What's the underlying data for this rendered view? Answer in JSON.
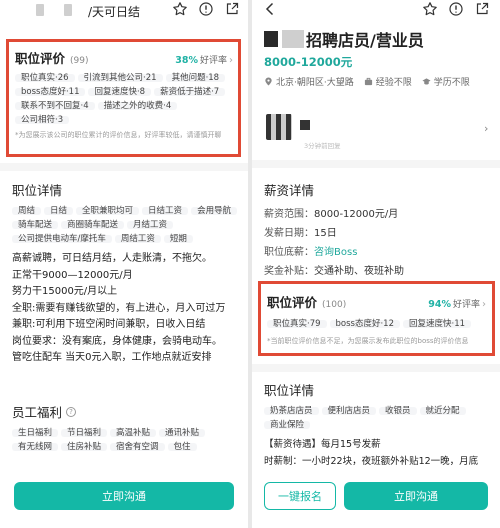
{
  "left": {
    "header": {
      "title": "/天可日结"
    },
    "evaluation": {
      "title": "职位评价",
      "count": "(99)",
      "percent": "38%",
      "good_label": "好评率",
      "tags": [
        "职位真实·26",
        "引流到其他公司·21",
        "其他问题·18",
        "boss态度好·11",
        "回复速度快·8",
        "薪资低于描述·7",
        "联系不到不回复·4",
        "描述之外的收费·4",
        "公司相符·3"
      ],
      "note": "*为您展示该公司的职位累计的评价信息，好评率较低，请谨慎开聊"
    },
    "details": {
      "title": "职位详情",
      "tags": [
        "周结",
        "日结",
        "全职兼职均可",
        "日结工资",
        "会用导航",
        "骑车配送",
        "商圈骑车配送",
        "月结工资",
        "公司提供电动车/摩托车",
        "周结工资",
        "短期"
      ],
      "lines": [
        "高薪诚聘，可日结月结，人走账清，不拖欠。",
        "正常干9000—12000元/月",
        "努力干15000元/月以上",
        "全职:需要有赚钱欲望的，有上进心，月入可过万",
        "兼职:可利用下班空闲时间兼职，日收入日结",
        "岗位要求：没有案底，身体健康，会骑电动车。",
        "管吃住配车 当天0元入职，工作地点就近安排"
      ]
    },
    "benefits": {
      "title": "员工福利",
      "tags": [
        "生日福利",
        "节日福利",
        "高温补贴",
        "通讯补贴",
        "有无线网",
        "住房补贴",
        "宿舍有空调",
        "包住"
      ]
    },
    "cta": "立即沟通"
  },
  "right": {
    "header": {},
    "job": {
      "title": "招聘店员/营业员",
      "salary": "8000-12000元",
      "location": "北京·朝阳区·大望路",
      "experience": "经验不限",
      "education": "学历不限"
    },
    "recruiter": {
      "status": "3分钟前回复"
    },
    "salary_info": {
      "title": "薪资详情",
      "range_label": "薪资范围：",
      "range": "8000-12000元/月",
      "payday_label": "发薪日期：",
      "payday": "15日",
      "base_label": "职位底薪：",
      "base": "咨询Boss",
      "bonus_label": "奖金补贴：",
      "bonus": "交通补助、夜班补助"
    },
    "evaluation": {
      "title": "职位评价",
      "count": "(100)",
      "percent": "94%",
      "good_label": "好评率",
      "tags": [
        "职位真实·79",
        "boss态度好·12",
        "回复速度快·11"
      ],
      "note": "*当前职位评价信息不足，为您展示发布此职位的boss的评价信息"
    },
    "details": {
      "title": "职位详情",
      "tags": [
        "奶茶店店员",
        "便利店店员",
        "收银员",
        "就近分配",
        "商业保险"
      ],
      "lines": [
        "【薪资待遇】每月15号发薪",
        "时薪制：一小时22块，夜班额外补贴12一晚，月底"
      ]
    },
    "apply_button": "一键报名",
    "cta": "立即沟通"
  },
  "colors": {
    "accent": "#14b8a6",
    "highlight_border": "#e04a35"
  }
}
